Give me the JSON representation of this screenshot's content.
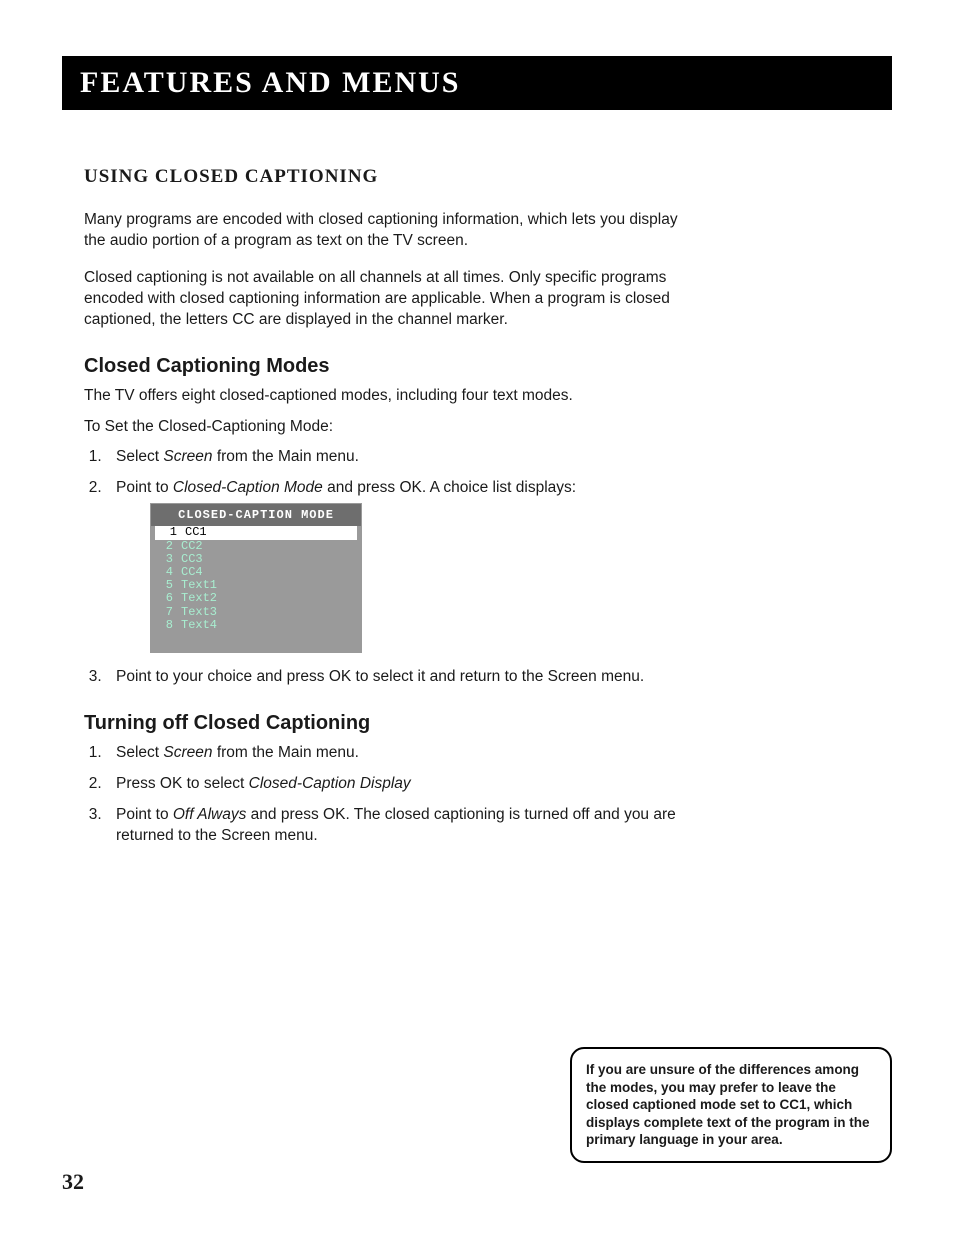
{
  "chapter_title": "Features and Menus",
  "section_title": "Using Closed Captioning",
  "intro_p1": "Many programs are encoded with closed captioning information, which lets you display the audio portion of a program as text on the TV screen.",
  "intro_p2": "Closed captioning is not available on all channels at all times. Only specific programs encoded with closed captioning information are applicable. When a program is closed captioned, the letters CC are displayed in the channel marker.",
  "modes": {
    "heading": "Closed Captioning Modes",
    "desc": "The TV offers eight closed-captioned modes, including four text modes.",
    "lead": "To Set the Closed-Captioning Mode:",
    "steps": {
      "s1_a": "Select ",
      "s1_b": "Screen",
      "s1_c": " from the Main menu.",
      "s2_a": "Point to ",
      "s2_b": "Closed-Caption Mode",
      "s2_c": " and press OK.  A choice list displays:",
      "s3": "Point to your choice and press OK to select it and return to the Screen menu."
    }
  },
  "menu": {
    "title": "CLOSED-CAPTION MODE",
    "items": [
      {
        "n": "1",
        "label": "CC1",
        "selected": true
      },
      {
        "n": "2",
        "label": "CC2",
        "selected": false
      },
      {
        "n": "3",
        "label": "CC3",
        "selected": false
      },
      {
        "n": "4",
        "label": "CC4",
        "selected": false
      },
      {
        "n": "5",
        "label": "Text1",
        "selected": false
      },
      {
        "n": "6",
        "label": "Text2",
        "selected": false
      },
      {
        "n": "7",
        "label": "Text3",
        "selected": false
      },
      {
        "n": "8",
        "label": "Text4",
        "selected": false
      }
    ]
  },
  "off": {
    "heading": "Turning off Closed Captioning",
    "steps": {
      "s1_a": "Select ",
      "s1_b": "Screen",
      "s1_c": " from the Main menu.",
      "s2_a": "Press OK to select ",
      "s2_b": "Closed-Caption Display",
      "s3_a": "Point to ",
      "s3_b": "Off Always",
      "s3_c": " and press OK. The closed captioning is turned off and you are returned to the Screen menu."
    }
  },
  "callout_text": " If you are unsure of the differences among the modes, you may prefer to leave the closed captioned mode set to CC1, which displays complete text of the program in the primary language in your area.",
  "page_number": "32"
}
